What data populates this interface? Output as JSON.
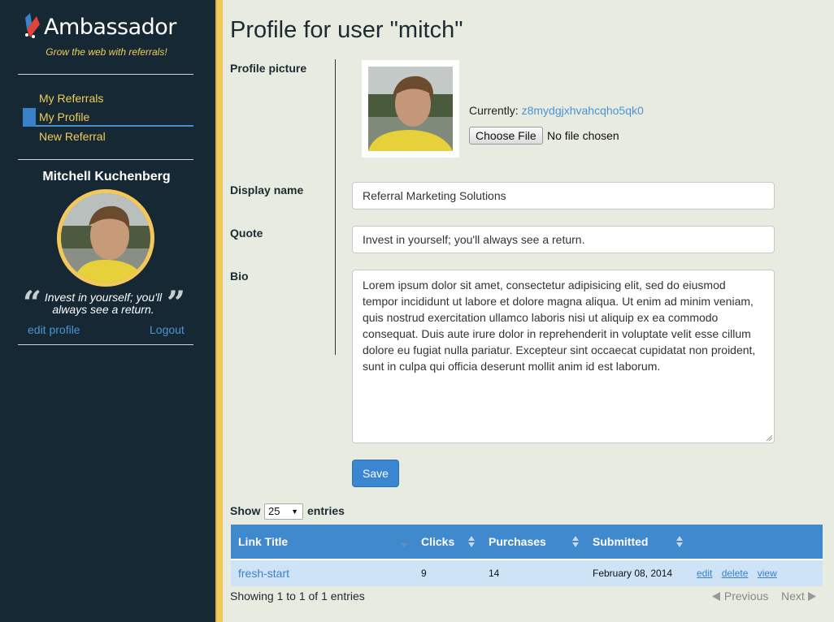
{
  "brand": {
    "name": "Ambassador",
    "tagline": "Grow the web with referrals!"
  },
  "nav": [
    {
      "label": "My Referrals",
      "active": false
    },
    {
      "label": "My Profile",
      "active": true
    },
    {
      "label": "New Referral",
      "active": false
    }
  ],
  "sidebar_user": {
    "name": "Mitchell Kuchenberg",
    "quote": "Invest in yourself; you'll always see a return.",
    "edit_link": "edit profile",
    "logout_link": "Logout"
  },
  "page": {
    "title": "Profile for user \"mitch\""
  },
  "form": {
    "picture_label": "Profile picture",
    "currently_label": "Currently:",
    "currently_value": "z8mydgjxhvahcqho5qk0",
    "choose_file": "Choose File",
    "no_file": "No file chosen",
    "display_name_label": "Display name",
    "display_name_value": "Referral Marketing Solutions",
    "quote_label": "Quote",
    "quote_value": "Invest in yourself; you'll always see a return.",
    "bio_label": "Bio",
    "bio_value": "Lorem ipsum dolor sit amet, consectetur adipisicing elit, sed do eiusmod tempor incididunt ut labore et dolore magna aliqua. Ut enim ad minim veniam, quis nostrud exercitation ullamco laboris nisi ut aliquip ex ea commodo consequat. Duis aute irure dolor in reprehenderit in voluptate velit esse cillum dolore eu fugiat nulla pariatur. Excepteur sint occaecat cupidatat non proident, sunt in culpa qui officia deserunt mollit anim id est laborum.",
    "save": "Save"
  },
  "table": {
    "show_label": "Show",
    "page_size": "25",
    "entries_label": "entries",
    "headers": [
      "Link Title",
      "Clicks",
      "Purchases",
      "Submitted"
    ],
    "rows": [
      {
        "title": "fresh-start",
        "clicks": "9",
        "purchases": "14",
        "submitted": "February 08, 2014",
        "actions": [
          "edit",
          "delete",
          "view"
        ]
      }
    ],
    "info": "Showing 1 to 1 of 1 entries",
    "previous": "Previous",
    "next": "Next"
  },
  "colors": {
    "sidebar": "#152833",
    "accent_gold": "#f2c85a",
    "link_blue": "#4a94d6",
    "header_blue": "#3f89cc",
    "row_blue": "#cfe3f7"
  }
}
